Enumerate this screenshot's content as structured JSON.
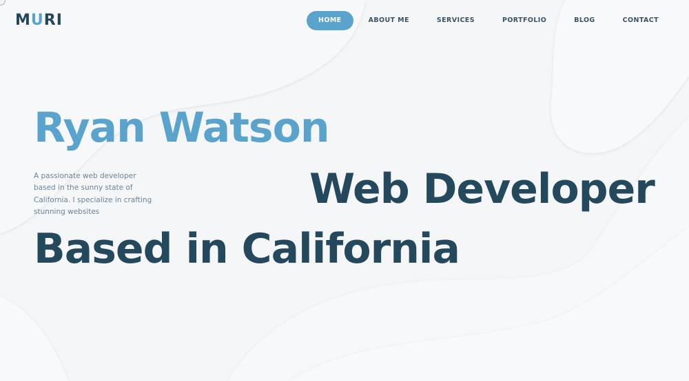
{
  "logo": {
    "prefix": "M",
    "accent": "U",
    "suffix": "RI"
  },
  "nav": {
    "items": [
      {
        "label": "HOME",
        "active": true
      },
      {
        "label": "ABOUT ME",
        "active": false
      },
      {
        "label": "SERVICES",
        "active": false
      },
      {
        "label": "PORTFOLIO",
        "active": false
      },
      {
        "label": "BLOG",
        "active": false
      },
      {
        "label": "CONTACT",
        "active": false
      }
    ]
  },
  "hero": {
    "name": "Ryan Watson",
    "description": "A passionate web developer based in the sunny state of California. I specialize in crafting stunning websites",
    "role": "Web Developer",
    "location": "Based in California"
  },
  "colors": {
    "accent": "#5aa3cd",
    "heading_dark": "#24485c",
    "body_text": "#6d8394",
    "background": "#f5f6f7"
  }
}
